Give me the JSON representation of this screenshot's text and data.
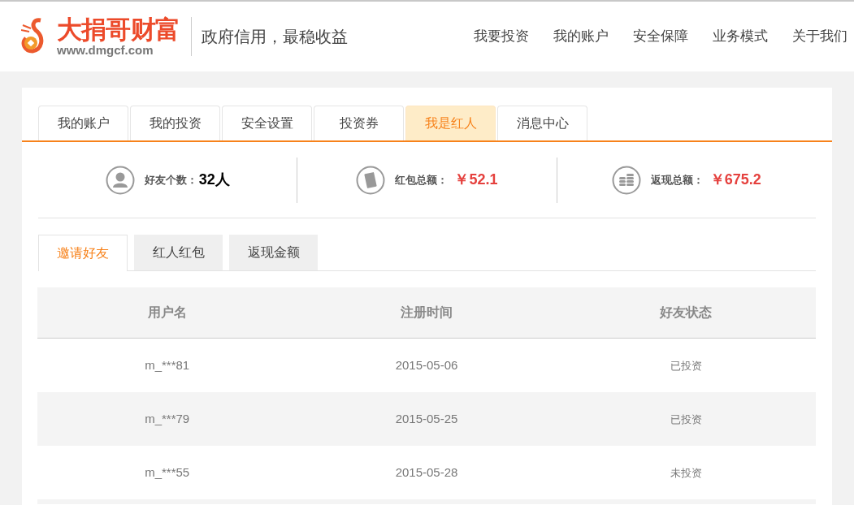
{
  "header": {
    "brand": "大捐哥财富",
    "url": "www.dmgcf.com",
    "slogan": "政府信用，最稳收益",
    "nav": [
      "我要投资",
      "我的账户",
      "安全保障",
      "业务模式",
      "关于我们"
    ]
  },
  "tabs": [
    {
      "label": "我的账户",
      "selected": false
    },
    {
      "label": "我的投资",
      "selected": false
    },
    {
      "label": "安全设置",
      "selected": false
    },
    {
      "label": "投资券",
      "selected": false
    },
    {
      "label": "我是红人",
      "selected": true
    },
    {
      "label": "消息中心",
      "selected": false
    }
  ],
  "stats": [
    {
      "kind": "friends",
      "label": "好友个数：",
      "value": "32人"
    },
    {
      "kind": "red_packet",
      "label": "红包总额：",
      "value": "￥52.1"
    },
    {
      "kind": "cashback",
      "label": "返现总额：",
      "value": "￥675.2"
    }
  ],
  "sub_tabs": [
    {
      "label": "邀请好友",
      "selected": true
    },
    {
      "label": "红人红包",
      "selected": false
    },
    {
      "label": "返现金额",
      "selected": false
    }
  ],
  "table": {
    "columns": [
      "用户名",
      "注册时间",
      "好友状态"
    ],
    "rows": [
      [
        "m_***81",
        "2015-05-06",
        "已投资"
      ],
      [
        "m_***79",
        "2015-05-25",
        "已投资"
      ],
      [
        "m_***55",
        "2015-05-28",
        "未投资"
      ]
    ]
  }
}
